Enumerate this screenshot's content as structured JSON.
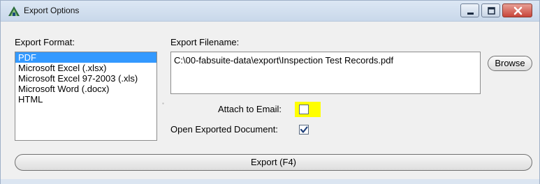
{
  "window": {
    "title": "Export Options",
    "icon": "app-logo-icon",
    "controls": [
      "minimize-icon",
      "maximize-icon",
      "close-icon"
    ]
  },
  "export_format": {
    "label": "Export Format:",
    "options": [
      "PDF",
      "Microsoft Excel (.xlsx)",
      "Microsoft Excel 97-2003 (.xls)",
      "Microsoft Word (.docx)",
      "HTML"
    ],
    "selected": "PDF"
  },
  "export_filename": {
    "label": "Export Filename:",
    "value": "C:\\00-fabsuite-data\\export\\Inspection Test Records.pdf",
    "browse_label": "Browse"
  },
  "attach_to_email": {
    "label": "Attach to Email:",
    "checked": false
  },
  "open_exported": {
    "label": "Open Exported Document:",
    "checked": true
  },
  "export_button": {
    "label": "Export (F4)"
  },
  "colors": {
    "selection": "#3399ff",
    "highlight": "#ffff00",
    "window_bg": "#f0f0f0"
  }
}
